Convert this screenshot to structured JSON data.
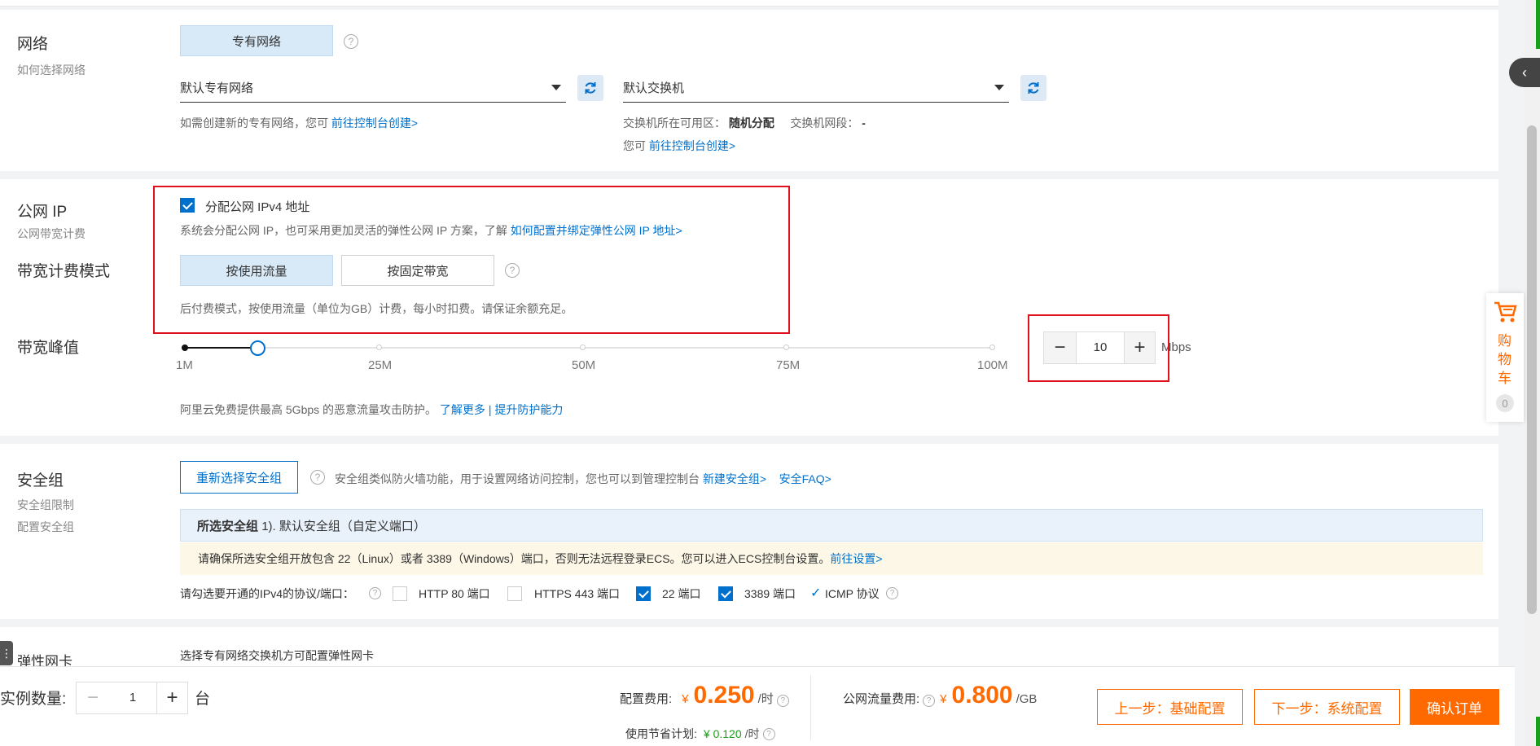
{
  "network": {
    "title": "网络",
    "subtitle": "如何选择网络",
    "vpc_button": "专有网络",
    "vpc_select": "默认专有网络",
    "vswitch_select": "默认交换机",
    "vpc_hint": "如需创建新的专有网络，您可",
    "vpc_hint_link": "前往控制台创建>",
    "vswitch_zone_label": "交换机所在可用区：",
    "vswitch_zone_value": "随机分配",
    "vswitch_cidr_label": "交换机网段：",
    "vswitch_cidr_value": "-",
    "vswitch_hint": "您可",
    "vswitch_hint_link": "前往控制台创建>"
  },
  "public_ip": {
    "title": "公网 IP",
    "subtitle": "公网带宽计费",
    "checkbox_label": "分配公网 IPv4 地址",
    "checked": true,
    "desc": "系统会分配公网 IP，也可采用更加灵活的弹性公网 IP 方案，了解",
    "desc_link": "如何配置并绑定弹性公网 IP 地址>",
    "billing_title": "带宽计费模式",
    "billing_options": [
      "按使用流量",
      "按固定带宽"
    ],
    "billing_selected": "按使用流量",
    "billing_desc": "后付费模式，按使用流量（单位为GB）计费，每小时扣费。请保证余额充足。",
    "peak_title": "带宽峰值",
    "slider_ticks": [
      "1M",
      "25M",
      "50M",
      "75M",
      "100M"
    ],
    "slider_value": 10,
    "slider_min": 1,
    "slider_max": 100,
    "bandwidth_value": "10",
    "bandwidth_unit": "Mbps",
    "ddos_text": "阿里云免费提供最高 5Gbps 的恶意流量攻击防护。",
    "ddos_link1": "了解更多",
    "ddos_sep": "|",
    "ddos_link2": "提升防护能力"
  },
  "security": {
    "title": "安全组",
    "subtitle1": "安全组限制",
    "subtitle2": "配置安全组",
    "reselect_button": "重新选择安全组",
    "desc": "安全组类似防火墙功能，用于设置网络访问控制，您也可以到管理控制台",
    "new_link": "新建安全组>",
    "faq_link": "安全FAQ>",
    "selected_label": "所选安全组",
    "selected_value": "1). 默认安全组（自定义端口）",
    "warning": "请确保所选安全组开放包含 22（Linux）或者 3389（Windows）端口，否则无法远程登录ECS。您可以进入ECS控制台设置。",
    "warning_link": "前往设置>",
    "ports_label": "请勾选要开通的IPv4的协议/端口：",
    "ports": [
      {
        "label": "HTTP 80 端口",
        "checked": false
      },
      {
        "label": "HTTPS 443 端口",
        "checked": false
      },
      {
        "label": "22 端口",
        "checked": true
      },
      {
        "label": "3389 端口",
        "checked": true
      }
    ],
    "icmp_label": "ICMP 协议"
  },
  "eni": {
    "title": "弹性网卡",
    "hint": "选择专有网络交换机方可配置弹性网卡"
  },
  "cart": {
    "label_chars": [
      "购",
      "物",
      "车"
    ],
    "count": "0"
  },
  "footer": {
    "qty_label": "实例数量:",
    "qty_value": "1",
    "qty_unit": "台",
    "config_fee_label": "配置费用:",
    "currency": "¥",
    "config_fee_value": "0.250",
    "per_hour": "/时",
    "savings_label": "使用节省计划:",
    "savings_value": "¥ 0.120",
    "traffic_fee_label": "公网流量费用:",
    "traffic_fee_value": "0.800",
    "per_gb": "/GB",
    "prev_button": "上一步：基础配置",
    "next_button": "下一步：系统配置",
    "confirm_button": "确认订单"
  },
  "colors": {
    "accent": "#0070cc",
    "orange": "#ff6a00",
    "highlight_box": "#e0101c"
  }
}
